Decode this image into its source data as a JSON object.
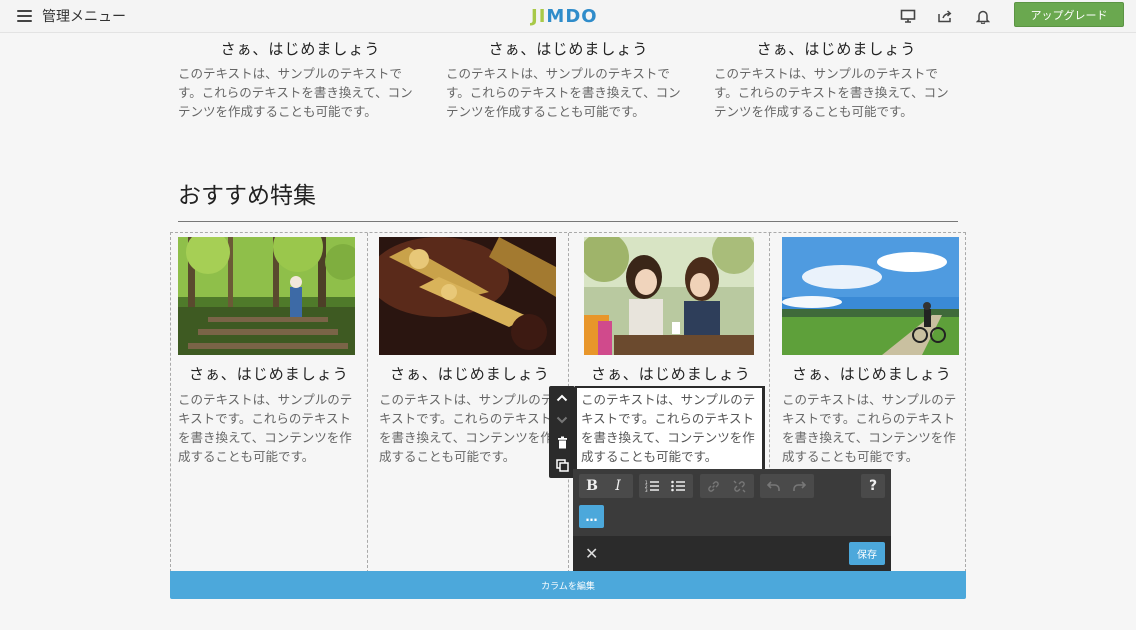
{
  "topbar": {
    "menu_label": "管理メニュー",
    "logo_text": "JIMDO",
    "upgrade_label": "アップグレード",
    "icons": [
      "monitor-icon",
      "share-icon",
      "bell-icon"
    ]
  },
  "top_columns": [
    {
      "title": "さぁ、はじめましょう",
      "text": "このテキストは、サンプルのテキストです。これらのテキストを書き換えて、コンテンツを作成することも可能です。"
    },
    {
      "title": "さぁ、はじめましょう",
      "text": "このテキストは、サンプルのテキストです。これらのテキストを書き換えて、コンテンツを作成することも可能です。"
    },
    {
      "title": "さぁ、はじめましょう",
      "text": "このテキストは、サンプルのテキストです。これらのテキストを書き換えて、コンテンツを作成することも可能です。"
    }
  ],
  "section": {
    "title": "おすすめ特集"
  },
  "cards": [
    {
      "title": "さぁ、はじめましょう",
      "text": "このテキストは、サンプルのテキストです。これらのテキストを書き換えて、コンテンツを作成することも可能です。",
      "image": "forest-child-photo"
    },
    {
      "title": "さぁ、はじめましょう",
      "text": "このテキストは、サンプルのテキストです。これらのテキストを書き換えて、コンテンツを作成することも可能です。",
      "image": "trumpet-photo"
    },
    {
      "title": "さぁ、はじめましょう",
      "text": "このテキストは、サンプルのテキストです。これらのテキストを書き換えて、コンテンツを作成することも可能です。",
      "image": "cafe-friends-photo"
    },
    {
      "title": "さぁ、はじめましょう",
      "text": "このテキストは、サンプルのテキストです。これらのテキストを書き換えて、コンテンツを作成することも可能です。",
      "image": "cyclist-landscape-photo"
    }
  ],
  "editor": {
    "text": "このテキストは、サンプルのテキストです。これらのテキストを書き換えて、コンテンツを作成することも可能です。",
    "bold": "B",
    "italic": "I",
    "help": "?",
    "more": "…",
    "close": "✕",
    "save_label": "保存"
  },
  "edit_columns_label": "カラムを編集",
  "colors": {
    "accent": "#4ca8db",
    "upgrade": "#6aa84f",
    "toolbar": "#3b3b3b"
  }
}
